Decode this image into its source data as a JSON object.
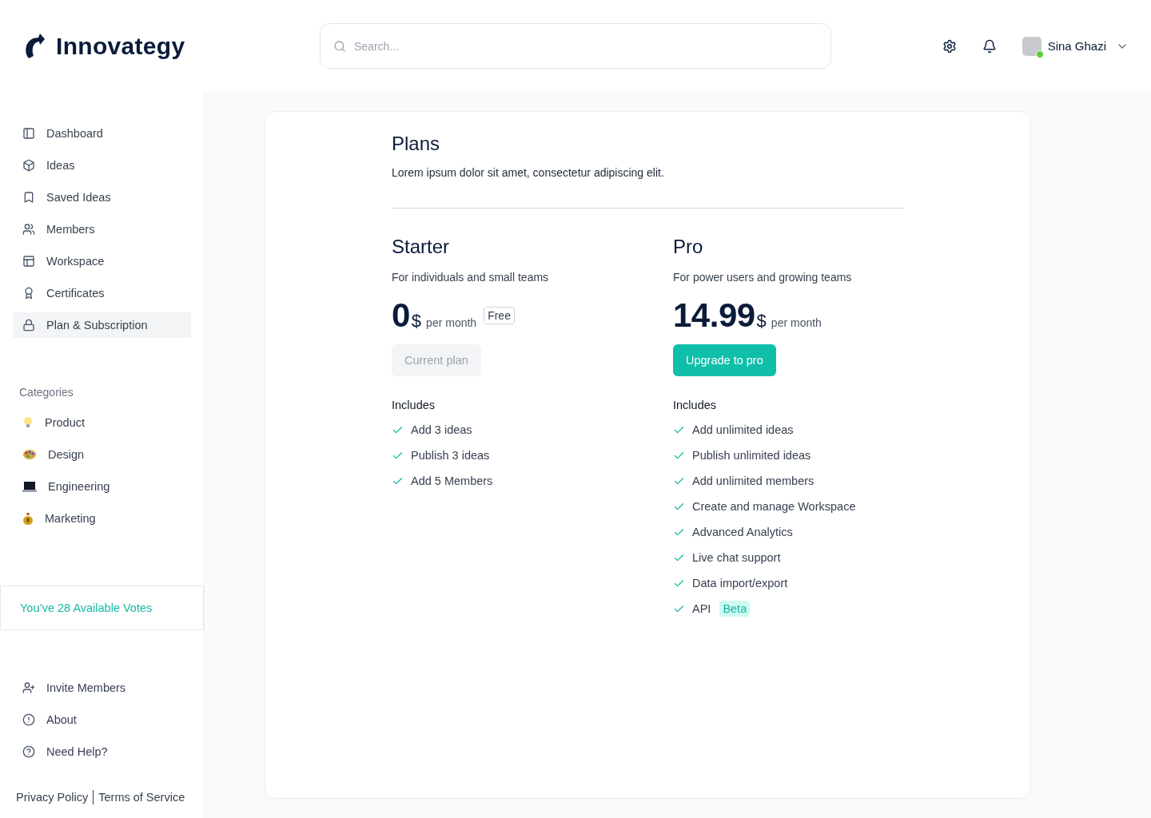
{
  "header": {
    "logo": "Innovategy",
    "search": {
      "placeholder": "Search..."
    },
    "user": {
      "name": "Sina Ghazi",
      "online": true
    }
  },
  "sidebar": {
    "nav": [
      {
        "label": "Dashboard",
        "selected": false
      },
      {
        "label": "Ideas",
        "selected": false
      },
      {
        "label": "Saved Ideas",
        "selected": false
      },
      {
        "label": "Members",
        "selected": false
      },
      {
        "label": "Workspace",
        "selected": false
      },
      {
        "label": "Certificates",
        "selected": false
      },
      {
        "label": "Plan & Subscription",
        "selected": true
      }
    ],
    "categories_title": "Categories",
    "categories": [
      {
        "label": "Product",
        "selected": false
      },
      {
        "label": "Design",
        "selected": false
      },
      {
        "label": "Engineering",
        "selected": false
      },
      {
        "label": "Marketing",
        "selected": false
      }
    ],
    "votes": "You’ve 28 Available Votes",
    "footer_nav": [
      {
        "label": "Invite Members"
      },
      {
        "label": "About"
      },
      {
        "label": "Need Help?"
      }
    ],
    "links": [
      "Privacy Policy",
      "Terms of Service"
    ]
  },
  "plans_page": {
    "title": "Plans",
    "subtitle": "Lorem ipsum dolor sit amet, consectetur adipiscing elit.",
    "plans": [
      {
        "name": "Starter",
        "description": "For individuals and small teams",
        "price": "0",
        "currency": "$",
        "period": "per month",
        "badge": "Free",
        "button": {
          "label": "Current plan",
          "disabled": true
        },
        "includes_title": "Includes",
        "features": [
          {
            "label": "Add 3 ideas"
          },
          {
            "label": "Publish 3 ideas"
          },
          {
            "label": "Add 5 Members"
          }
        ]
      },
      {
        "name": "Pro",
        "description": "For power users and growing teams",
        "price": "14.99",
        "currency": "$",
        "period": "per month",
        "button": {
          "label": "Upgrade to pro",
          "disabled": false
        },
        "includes_title": "Includes",
        "features": [
          {
            "label": "Add unlimited ideas"
          },
          {
            "label": "Publish unlimited ideas"
          },
          {
            "label": "Add unlimited members"
          },
          {
            "label": "Create and manage Workspace"
          },
          {
            "label": "Advanced Analytics"
          },
          {
            "label": "Live chat support"
          },
          {
            "label": "Data import/export"
          },
          {
            "label": "API",
            "badge": "Beta"
          }
        ]
      }
    ]
  }
}
